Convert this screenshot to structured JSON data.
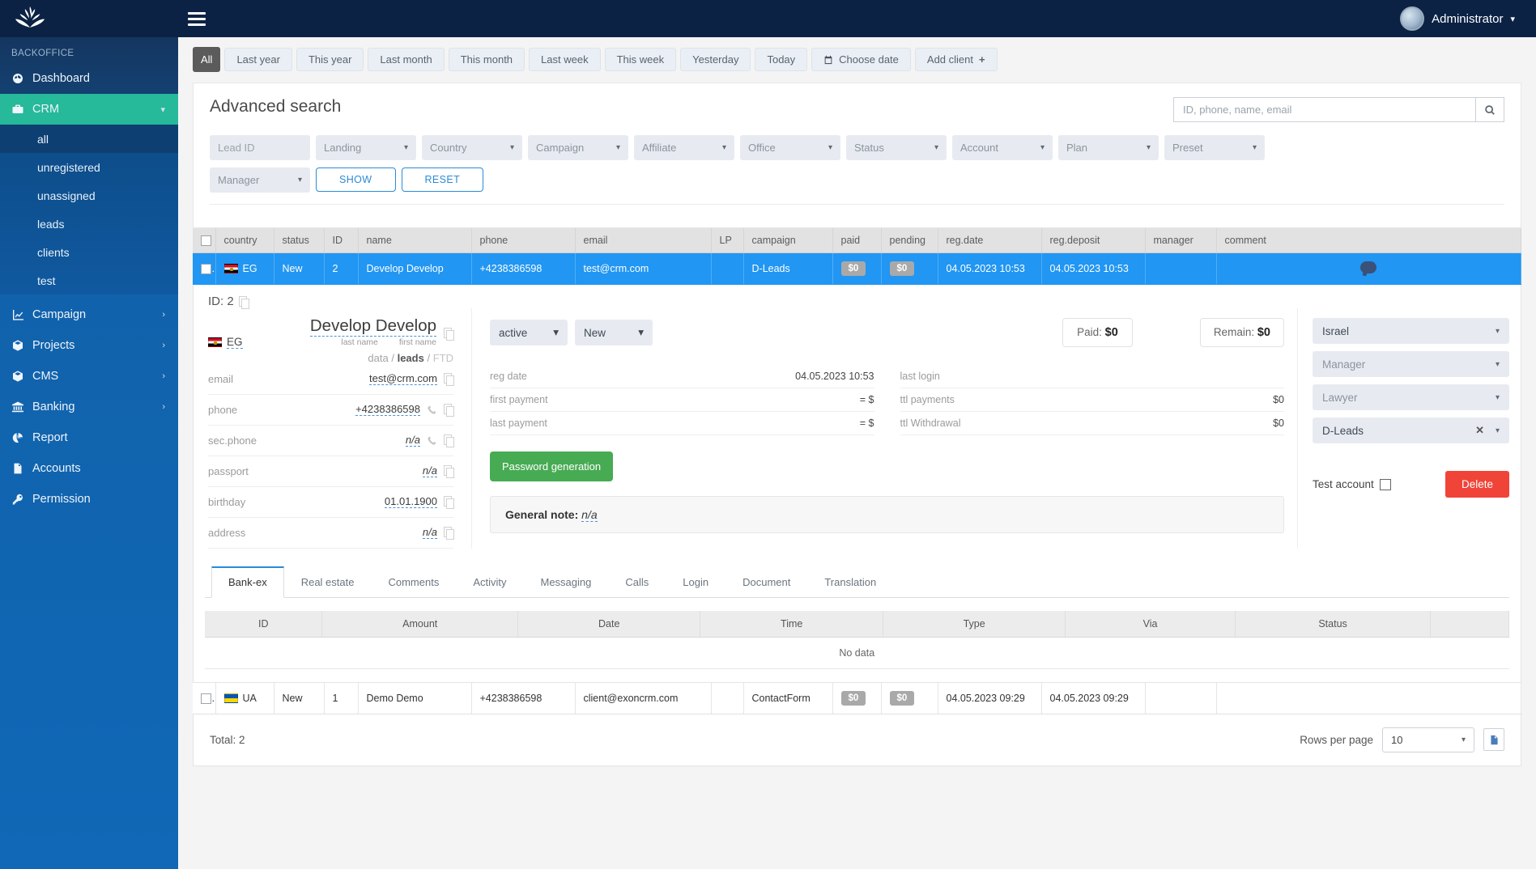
{
  "topbar": {
    "admin_label": "Administrator",
    "menu_icon": "hamburger-icon",
    "logo_icon": "lotus-logo-icon"
  },
  "sidebar": {
    "section_label": "BACKOFFICE",
    "items": [
      {
        "label": "Dashboard",
        "icon": "gauge-icon",
        "has_arrow": false
      },
      {
        "label": "CRM",
        "icon": "briefcase-icon",
        "has_arrow": true,
        "active": true
      },
      {
        "label": "Campaign",
        "icon": "chart-line-icon",
        "has_arrow": true
      },
      {
        "label": "Projects",
        "icon": "box-icon",
        "has_arrow": true
      },
      {
        "label": "CMS",
        "icon": "box-icon",
        "has_arrow": true
      },
      {
        "label": "Banking",
        "icon": "bank-icon",
        "has_arrow": true
      },
      {
        "label": "Report",
        "icon": "pie-chart-icon",
        "has_arrow": false
      },
      {
        "label": "Accounts",
        "icon": "invoice-icon",
        "has_arrow": false
      },
      {
        "label": "Permission",
        "icon": "key-icon",
        "has_arrow": false
      }
    ],
    "crm_sub": [
      {
        "label": "all",
        "current": true
      },
      {
        "label": "unregistered"
      },
      {
        "label": "unassigned"
      },
      {
        "label": "leads"
      },
      {
        "label": "clients"
      },
      {
        "label": "test"
      }
    ]
  },
  "filterbar": {
    "buttons": [
      {
        "label": "All",
        "selected": true
      },
      {
        "label": "Last year"
      },
      {
        "label": "This year"
      },
      {
        "label": "Last month"
      },
      {
        "label": "This month"
      },
      {
        "label": "Last week"
      },
      {
        "label": "This week"
      },
      {
        "label": "Yesterday"
      },
      {
        "label": "Today"
      }
    ],
    "choose_date": "Choose date",
    "add_client": "Add client",
    "add_client_plus": "+"
  },
  "search_panel": {
    "title": "Advanced search",
    "search_placeholder": "ID, phone, name, email",
    "search_value": "",
    "selects": [
      {
        "label": "Lead ID",
        "type": "text"
      },
      {
        "label": "Landing",
        "type": "select"
      },
      {
        "label": "Country",
        "type": "select"
      },
      {
        "label": "Campaign",
        "type": "select"
      },
      {
        "label": "Affiliate",
        "type": "select"
      },
      {
        "label": "Office",
        "type": "select"
      },
      {
        "label": "Status",
        "type": "select"
      },
      {
        "label": "Account",
        "type": "select"
      },
      {
        "label": "Plan",
        "type": "select"
      },
      {
        "label": "Preset",
        "type": "select"
      },
      {
        "label": "Manager",
        "type": "select"
      }
    ],
    "show_button": "SHOW",
    "reset_button": "RESET"
  },
  "grid": {
    "headers": [
      "country",
      "status",
      "ID",
      "name",
      "phone",
      "email",
      "LP",
      "campaign",
      "paid",
      "pending",
      "reg.date",
      "reg.deposit",
      "manager",
      "comment"
    ],
    "rows": [
      {
        "country": "EG",
        "flag": "flag-eg",
        "status": "New",
        "id": "2",
        "name": "Develop Develop",
        "phone": "+4238386598",
        "email": "test@crm.com",
        "lp": "",
        "campaign": "D-Leads",
        "paid": "$0",
        "pending": "$0",
        "reg_date": "04.05.2023 10:53",
        "reg_deposit": "04.05.2023 10:53",
        "manager": "",
        "comment_icon": "comment-bubble-icon",
        "selected": true
      },
      {
        "country": "UA",
        "flag": "flag-ua",
        "status": "New",
        "id": "1",
        "name": "Demo Demo",
        "phone": "+4238386598",
        "email": "client@exoncrm.com",
        "lp": "",
        "campaign": "ContactForm",
        "paid": "$0",
        "pending": "$0",
        "reg_date": "04.05.2023 09:29",
        "reg_deposit": "04.05.2023 09:29",
        "manager": "",
        "comment_icon": "",
        "selected": false
      }
    ]
  },
  "detail": {
    "id_label": "ID: 2",
    "country_code": "EG",
    "full_name": "Develop Develop",
    "last_name_label": "last name",
    "first_name_label": "first name",
    "crumb_data": "data",
    "crumb_leads": "leads",
    "crumb_ftd": "FTD",
    "crumb_sep": "/",
    "fields": [
      {
        "key": "email",
        "value": "test@crm.com",
        "na": false,
        "phone_icon": false
      },
      {
        "key": "phone",
        "value": "+4238386598",
        "na": false,
        "phone_icon": true
      },
      {
        "key": "sec.phone",
        "value": "n/a",
        "na": true,
        "phone_icon": true
      },
      {
        "key": "passport",
        "value": "n/a",
        "na": true,
        "phone_icon": false
      },
      {
        "key": "birthday",
        "value": "01.01.1900",
        "na": false,
        "phone_icon": false
      },
      {
        "key": "address",
        "value": "n/a",
        "na": true,
        "phone_icon": false
      }
    ],
    "state_select": "active",
    "status_select": "New",
    "paid_label": "Paid:",
    "paid_value": "$0",
    "remain_label": "Remain:",
    "remain_value": "$0",
    "left_rows": [
      {
        "key": "reg date",
        "value": "04.05.2023 10:53"
      },
      {
        "key": "first payment",
        "value": "= $"
      },
      {
        "key": "last payment",
        "value": "= $"
      }
    ],
    "right_rows": [
      {
        "key": "last login",
        "value": ""
      },
      {
        "key": "ttl payments",
        "value": "$0"
      },
      {
        "key": "ttl Withdrawal",
        "value": "$0"
      }
    ],
    "password_button": "Password generation",
    "note_label": "General note:",
    "note_value": "n/a",
    "right_selects": [
      {
        "label": "Israel",
        "placeholder": false,
        "clearable": false
      },
      {
        "label": "Manager",
        "placeholder": true,
        "clearable": false
      },
      {
        "label": "Lawyer",
        "placeholder": true,
        "clearable": false
      },
      {
        "label": "D-Leads",
        "placeholder": false,
        "clearable": true
      }
    ],
    "test_account_label": "Test account",
    "delete_button": "Delete",
    "tabs": [
      {
        "label": "Bank-ex",
        "active": true
      },
      {
        "label": "Real estate"
      },
      {
        "label": "Comments"
      },
      {
        "label": "Activity"
      },
      {
        "label": "Messaging"
      },
      {
        "label": "Calls"
      },
      {
        "label": "Login"
      },
      {
        "label": "Document"
      },
      {
        "label": "Translation"
      }
    ],
    "sub_headers": [
      "ID",
      "Amount",
      "Date",
      "Time",
      "Type",
      "Via",
      "Status",
      ""
    ],
    "sub_empty": "No data"
  },
  "footer": {
    "total": "Total: 2",
    "rows_per_page_label": "Rows per page",
    "rows_per_page_value": "10",
    "export_icon": "excel-export-icon"
  },
  "colors": {
    "topbar": "#0b2244",
    "sidebar_active": "#26b99a",
    "row_selected": "#2196f3",
    "delete": "#f04438",
    "green": "#47ab53",
    "link_blue": "#2b8ad6"
  }
}
